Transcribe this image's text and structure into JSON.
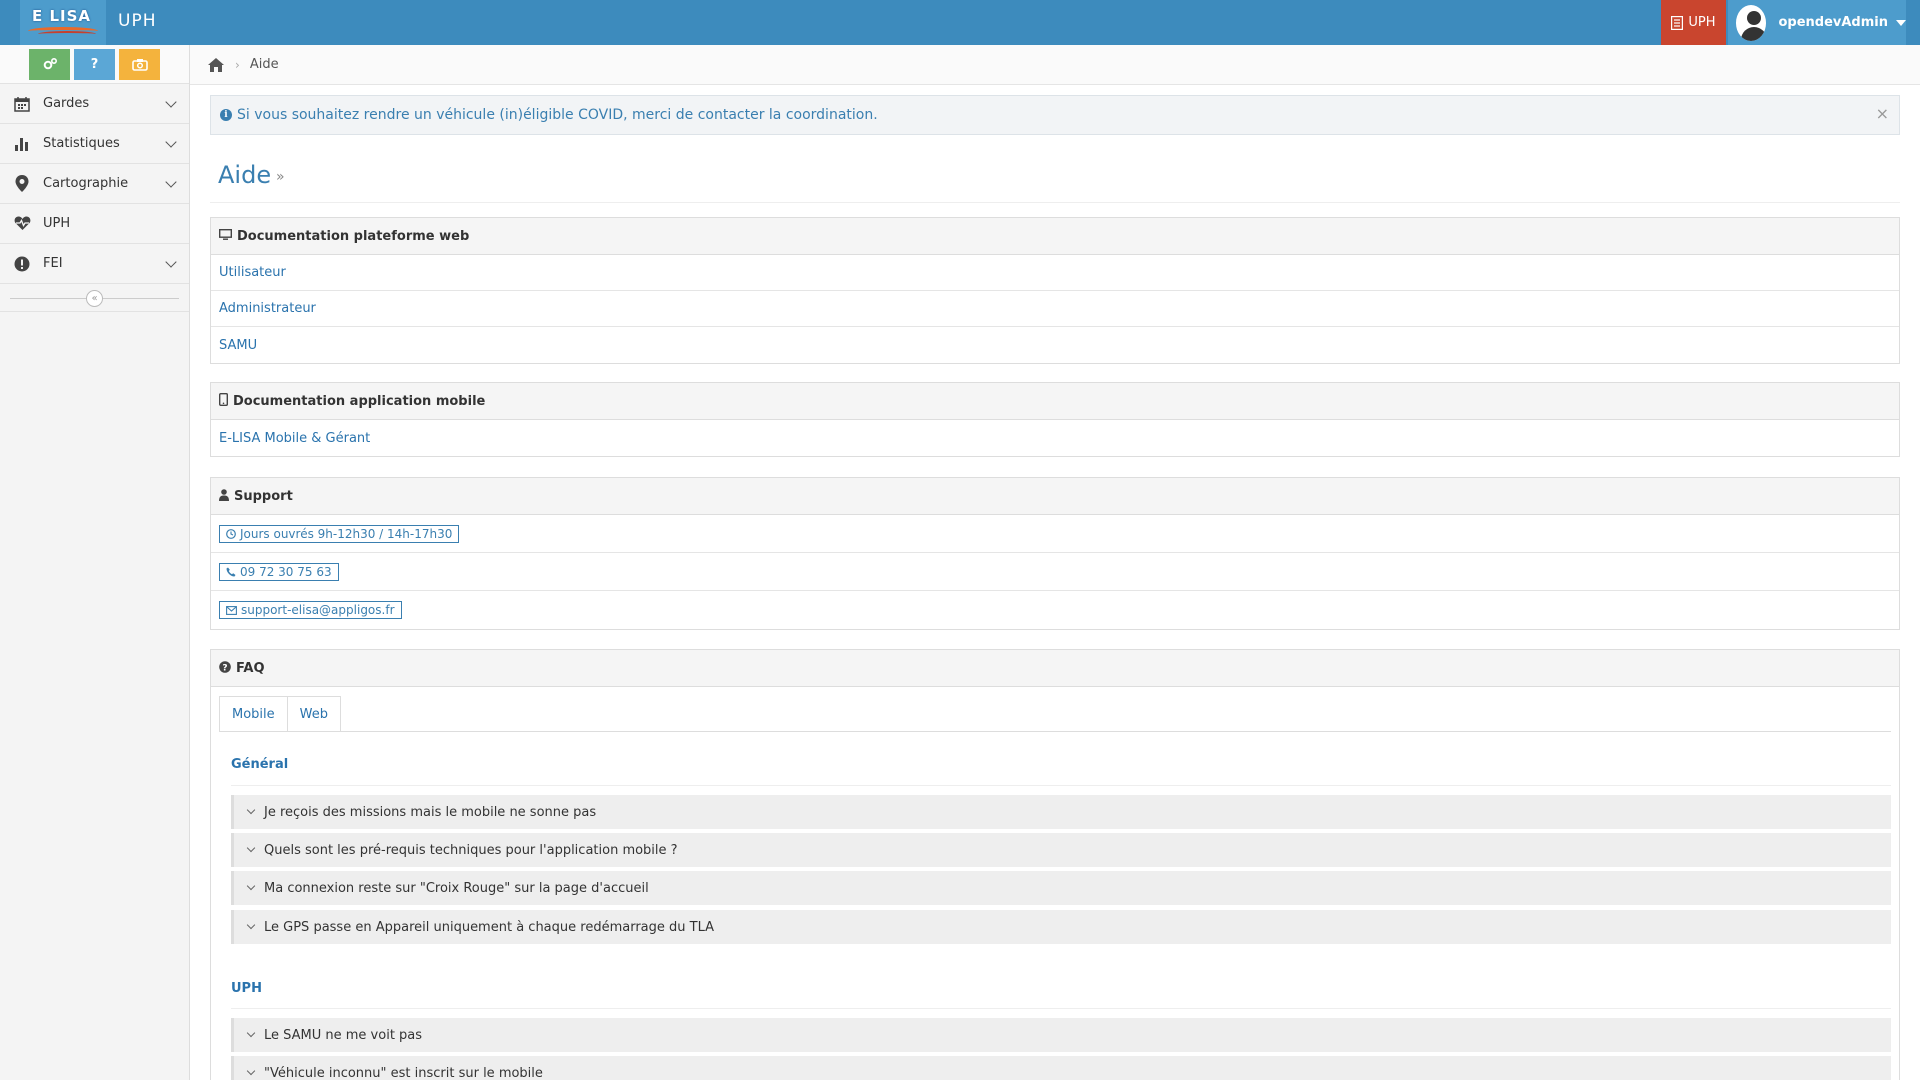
{
  "header": {
    "logo_text": "E LISA",
    "app_title": "UPH",
    "uph_button_label": "UPH",
    "user_name": "opendevAdmin"
  },
  "quick_buttons": [
    {
      "name": "settings-button",
      "icon": "cogs-icon",
      "label": "",
      "color": "#6cb36a"
    },
    {
      "name": "help-button",
      "icon": "question-icon",
      "label": "?",
      "color": "#5ba7d6"
    },
    {
      "name": "screenshot-button",
      "icon": "camera-icon",
      "label": "",
      "color": "#f4b33d"
    }
  ],
  "sidebar": {
    "items": [
      {
        "label": "Gardes",
        "icon": "calendar-icon",
        "has_submenu": true
      },
      {
        "label": "Statistiques",
        "icon": "bar-chart-icon",
        "has_submenu": true
      },
      {
        "label": "Cartographie",
        "icon": "map-marker-icon",
        "has_submenu": true
      },
      {
        "label": "UPH",
        "icon": "heartbeat-icon",
        "has_submenu": false
      },
      {
        "label": "FEI",
        "icon": "exclamation-circle-icon",
        "has_submenu": true
      }
    ]
  },
  "breadcrumb": {
    "current": "Aide"
  },
  "alert": {
    "text": "Si vous souhaitez rendre un véhicule (in)éligible COVID, merci de contacter la coordination."
  },
  "page": {
    "title": "Aide",
    "title_suffix": "»"
  },
  "panels": {
    "web_doc": {
      "title": "Documentation plateforme web",
      "links": [
        "Utilisateur",
        "Administrateur",
        "SAMU"
      ]
    },
    "mobile_doc": {
      "title": "Documentation application mobile",
      "links": [
        "E-LISA Mobile & Gérant"
      ]
    },
    "support": {
      "title": "Support",
      "hours": "Jours ouvrés 9h-12h30 / 14h-17h30",
      "phone": "09 72 30 75 63",
      "email": "support-elisa@appligos.fr"
    },
    "faq": {
      "title": "FAQ",
      "tabs": [
        "Mobile",
        "Web"
      ],
      "sections": [
        {
          "title": "Général",
          "questions": [
            "Je reçois des missions mais le mobile ne sonne pas",
            "Quels sont les pré-requis techniques pour l'application mobile ?",
            "Ma connexion reste sur \"Croix Rouge\" sur la page d'accueil",
            "Le GPS passe en Appareil uniquement à chaque redémarrage du TLA"
          ]
        },
        {
          "title": "UPH",
          "questions": [
            "Le SAMU ne me voit pas",
            "\"Véhicule inconnu\" est inscrit sur le mobile"
          ]
        }
      ]
    }
  },
  "colors": {
    "navbar": "#3d8bbd",
    "accent": "#2a73ad",
    "uph_button": "#c9452e"
  }
}
